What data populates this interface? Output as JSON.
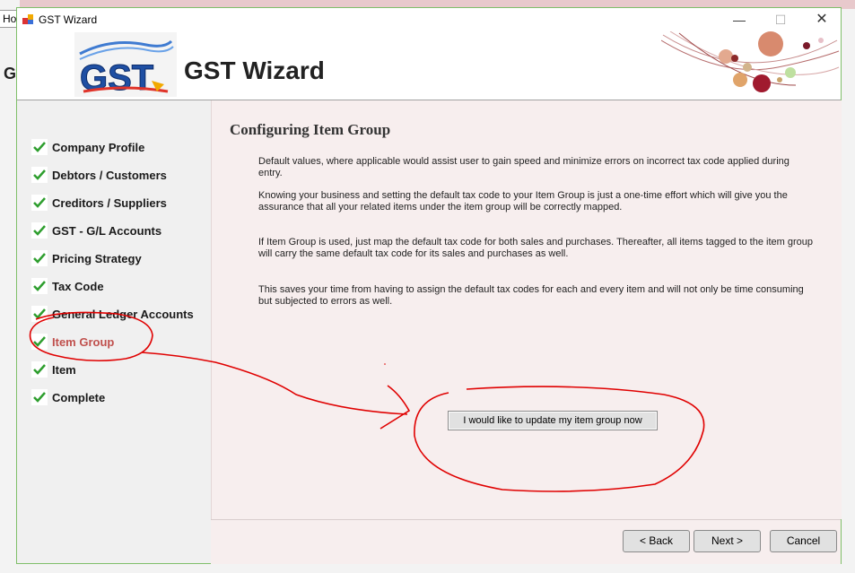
{
  "background": {
    "tab_label": "Ho",
    "side_letter": "G"
  },
  "window": {
    "title": "GST Wizard"
  },
  "header": {
    "logo_text": "GST",
    "title": "GST Wizard"
  },
  "steps": [
    {
      "label": "Company Profile",
      "done": true
    },
    {
      "label": "Debtors / Customers",
      "done": true
    },
    {
      "label": "Creditors / Suppliers",
      "done": true
    },
    {
      "label": "GST - G/L Accounts",
      "done": true
    },
    {
      "label": "Pricing Strategy",
      "done": true
    },
    {
      "label": "Tax Code",
      "done": true
    },
    {
      "label": "General Ledger Accounts",
      "done": true
    },
    {
      "label": "Item Group",
      "done": true,
      "active": true
    },
    {
      "label": "Item",
      "done": true
    },
    {
      "label": "Complete",
      "done": true
    }
  ],
  "content": {
    "title": "Configuring Item Group",
    "paragraphs": [
      "Default values, where applicable would assist user to gain speed and minimize errors on incorrect tax code applied during entry.",
      "Knowing your business and setting the default tax code to your Item Group is just a one-time effort which will give you the assurance that all your related items under the item group will be correctly mapped.",
      "If Item Group is used, just map the default tax code for both sales and purchases. Thereafter, all items tagged to the item group will carry the same default tax code for its sales and purchases as well.",
      "This saves your time from having to assign the default tax codes for each and every item and will not only be time consuming but subjected to errors as well."
    ],
    "update_button": "I would like to update my item group now"
  },
  "footer": {
    "back": "< Back",
    "next": "Next >",
    "cancel": "Cancel"
  },
  "colors": {
    "active_step": "#c0504d",
    "check": "#2e9e2e",
    "annotation": "#e00000",
    "content_bg": "#f7eeee"
  }
}
